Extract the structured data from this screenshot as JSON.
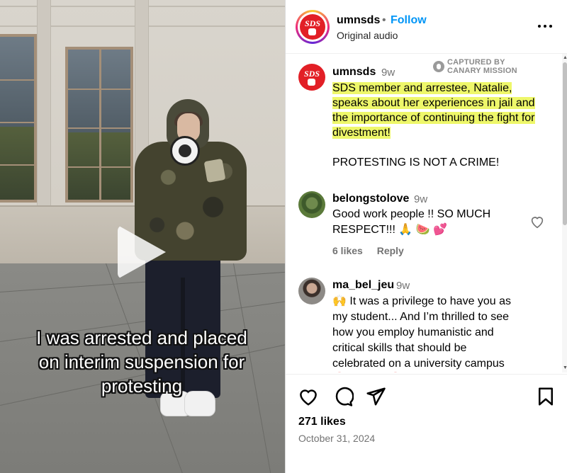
{
  "video": {
    "caption_lines": [
      "I was arrested and placed",
      "on interim suspension for",
      "protesting"
    ],
    "play_icon": "play-icon"
  },
  "header": {
    "username": "umnsds",
    "separator": "•",
    "follow_label": "Follow",
    "audio_label": "Original audio",
    "logo_text": "SDS",
    "more_icon": "more-options-icon"
  },
  "post": {
    "username": "umnsds",
    "time": "9w",
    "watermark_line1": "CAPTURED BY",
    "watermark_line2": "CANARY MISSION",
    "highlighted_text": "SDS member and arrestee, Natalie, speaks about her experiences in jail and the importance of continuing the fight for divestment!",
    "text2": "PROTESTING IS NOT A CRIME!"
  },
  "comments": [
    {
      "username": "belongstolove",
      "time": "9w",
      "text": "Good work people !! SO MUCH RESPECT!!! 🙏 🍉 💕",
      "likes": "6 likes",
      "reply": "Reply"
    },
    {
      "username": "ma_bel_jeu",
      "time": "9w",
      "text": "🙌 It was a privilege to have you as my student... And I’m thrilled to see how you employ humanistic and critical skills that should be celebrated on a university campus ❗BRAVO ❗"
    }
  ],
  "footer": {
    "likes": "271 likes",
    "date": "October 31, 2024"
  },
  "colors": {
    "accent": "#0095f6",
    "highlight": "#eef76a",
    "brand_red": "#e21f26"
  }
}
